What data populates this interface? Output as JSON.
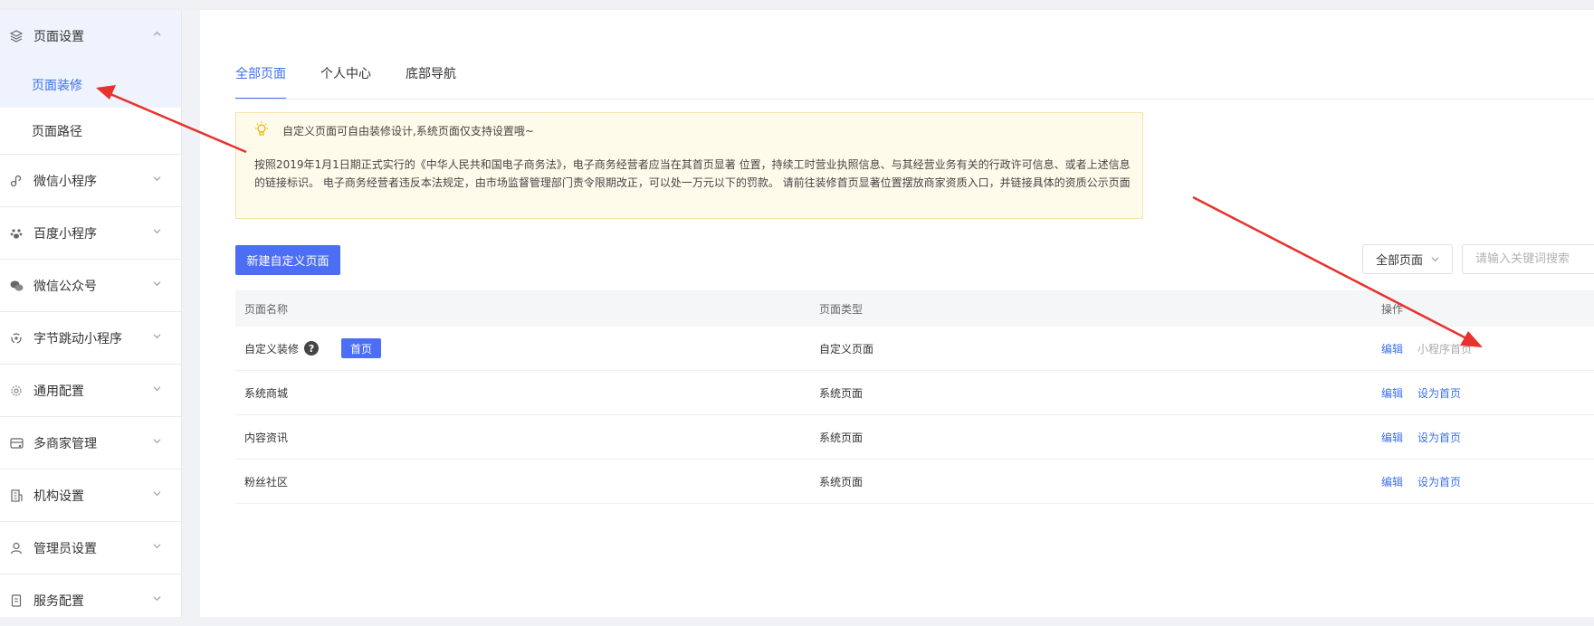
{
  "sidebar": {
    "groups": [
      {
        "label": "页面设置",
        "icon": "layers-icon",
        "open": true,
        "children": [
          "页面装修",
          "页面路径"
        ]
      },
      {
        "label": "微信小程序",
        "icon": "link-icon"
      },
      {
        "label": "百度小程序",
        "icon": "paw-icon"
      },
      {
        "label": "微信公众号",
        "icon": "wechat-icon"
      },
      {
        "label": "字节跳动小程序",
        "icon": "bytedance-icon"
      },
      {
        "label": "通用配置",
        "icon": "gear-icon"
      },
      {
        "label": "多商家管理",
        "icon": "store-icon"
      },
      {
        "label": "机构设置",
        "icon": "building-icon"
      },
      {
        "label": "管理员设置",
        "icon": "user-icon"
      },
      {
        "label": "服务配置",
        "icon": "document-icon"
      }
    ]
  },
  "tabs": [
    "全部页面",
    "个人中心",
    "底部导航"
  ],
  "notice": {
    "tip": "自定义页面可自由装修设计,系统页面仅支持设置哦~",
    "body": "按照2019年1月1日期正式实行的《中华人民共和国电子商务法》，电子商务经营者应当在其首页显著 位置，持续工时营业执照信息、与其经营业务有关的行政许可信息、或者上述信息的链接标识。 电子商务经营者违反本法规定，由市场监督管理部门责令限期改正，可以处一万元以下的罚款。 请前往装修首页显著位置摆放商家资质入口，并链接具体的资质公示页面"
  },
  "toolbar": {
    "new_button": "新建自定义页面",
    "filter_value": "全部页面",
    "search_placeholder": "请输入关键词搜索"
  },
  "table": {
    "headers": {
      "name": "页面名称",
      "type": "页面类型",
      "ops": "操作"
    },
    "rows": [
      {
        "name": "自定义装修",
        "help": "?",
        "badge": "首页",
        "type": "自定义页面",
        "edit": "编辑",
        "action": "小程序首页"
      },
      {
        "name": "系统商城",
        "type": "系统页面",
        "edit": "编辑",
        "action": "设为首页"
      },
      {
        "name": "内容资讯",
        "type": "系统页面",
        "edit": "编辑",
        "action": "设为首页"
      },
      {
        "name": "粉丝社区",
        "type": "系统页面",
        "edit": "编辑",
        "action": "设为首页"
      }
    ]
  },
  "colors": {
    "accent": "#4c6ef5",
    "link": "#3d6ff0",
    "annotation": "#e8322d",
    "notice_bg": "#fffbeb"
  }
}
